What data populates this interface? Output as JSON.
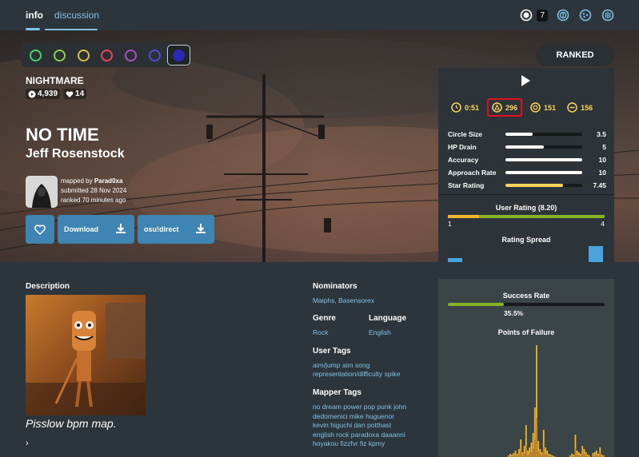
{
  "tabs": [
    {
      "label": "info",
      "active": true
    },
    {
      "label": "discussion",
      "active": false
    }
  ],
  "top_icons": [
    {
      "icon": "osu-mode-icon",
      "badge": "7"
    },
    {
      "icon": "taiko-mode-icon"
    },
    {
      "icon": "catch-mode-icon"
    },
    {
      "icon": "mania-mode-icon"
    }
  ],
  "difficulties": [
    {
      "color": "#4bd16f"
    },
    {
      "color": "#8cd04a"
    },
    {
      "color": "#d6c24a"
    },
    {
      "color": "#e9465c"
    },
    {
      "color": "#b04ac4"
    },
    {
      "color": "#5c4ad6"
    },
    {
      "color": "#2a2ab4",
      "active": true
    }
  ],
  "beatmap": {
    "difficulty_name": "NIGHTMARE",
    "play_count": "4,939",
    "favourite_count": "14",
    "title": "NO TIME",
    "artist": "Jeff Rosenstock",
    "mapped_by_prefix": "mapped by",
    "mapper": "Parad0xa",
    "submitted": "submitted 28 Nov 2024",
    "ranked": "ranked 70 minutes ago",
    "status": "RANKED"
  },
  "buttons": {
    "download": "Download",
    "osudirect": "osu!direct"
  },
  "meta": {
    "length": "0:51",
    "bpm": "296",
    "circles": "151",
    "sliders": "156"
  },
  "attributes": [
    {
      "label": "Circle Size",
      "value": "3.5",
      "fill": 0.35,
      "color": "#ffffff"
    },
    {
      "label": "HP Drain",
      "value": "5",
      "fill": 0.5,
      "color": "#ffffff"
    },
    {
      "label": "Accuracy",
      "value": "10",
      "fill": 1.0,
      "color": "#ffffff"
    },
    {
      "label": "Approach Rate",
      "value": "10",
      "fill": 1.0,
      "color": "#ffffff"
    },
    {
      "label": "Star Rating",
      "value": "7.45",
      "fill": 0.745,
      "color": "#ffd45a"
    }
  ],
  "user_rating": {
    "title": "User Rating (8.20)",
    "negative": "1",
    "positive": "4",
    "negative_fraction": 0.2
  },
  "rating_spread": {
    "title": "Rating Spread"
  },
  "description": {
    "heading": "Description",
    "text": "Pisslow bpm map.",
    "more": "›"
  },
  "info": {
    "nominators_heading": "Nominators",
    "nominators": "Maiphs, Basensorex",
    "genre_heading": "Genre",
    "genre": "Rock",
    "language_heading": "Language",
    "language": "English",
    "user_tags_heading": "User Tags",
    "user_tags_line1": "aim/jump aim song",
    "user_tags_line2": "representation/difficulty spike",
    "mapper_tags_heading": "Mapper Tags",
    "mapper_tags_lines": [
      "no dream power pop punk john",
      "dedomenici mike huguenor",
      "kevin higuchi dan potthast",
      "english rock paradoxa daaanni",
      "hoyakou fizzfvr fiz kpmy"
    ]
  },
  "success": {
    "title": "Success Rate",
    "percent": "35.5%",
    "fraction": 0.355,
    "failure_title": "Points of Failure"
  },
  "colors": {
    "accent": "#7fc3e8",
    "button": "#3e85b4",
    "star_yellow": "#ffd45a",
    "positive_green": "#88b226",
    "negative_orange": "#f0b62a",
    "highlight_red": "#e0111c"
  }
}
